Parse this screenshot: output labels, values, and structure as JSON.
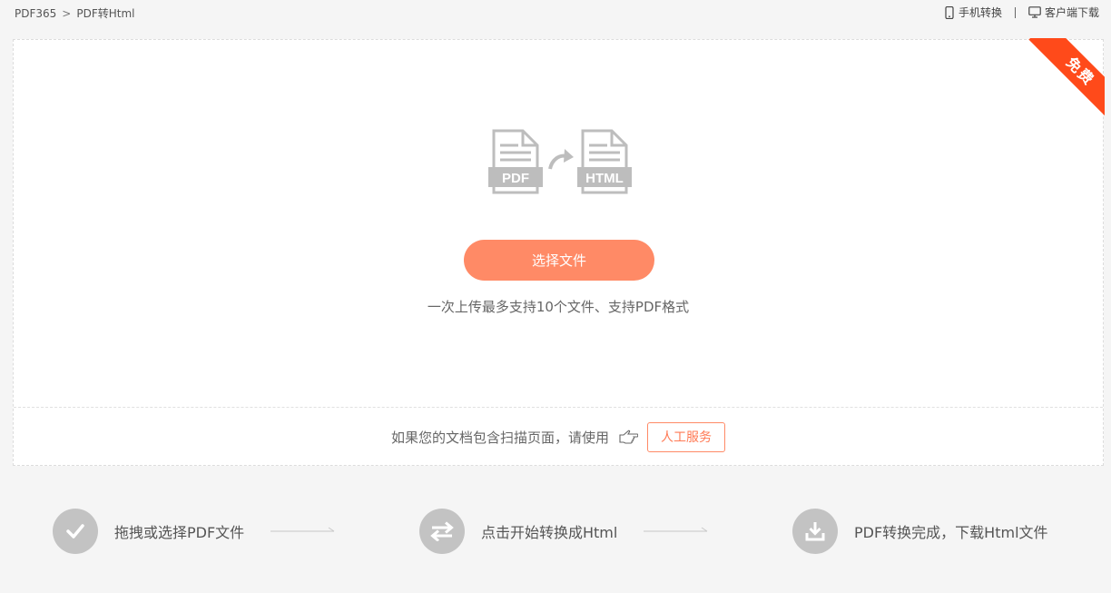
{
  "breadcrumb": {
    "home": "PDF365",
    "separator": ">",
    "current": "PDF转Html"
  },
  "top_links": {
    "mobile": "手机转换",
    "desktop": "客户端下载"
  },
  "ribbon": {
    "label": "免费"
  },
  "convert_icon": {
    "from": "PDF",
    "to": "HTML"
  },
  "upload": {
    "button_label": "选择文件",
    "hint": "一次上传最多支持10个文件、支持PDF格式"
  },
  "service": {
    "text": "如果您的文档包含扫描页面，请使用",
    "button_label": "人工服务"
  },
  "steps": [
    {
      "label": "拖拽或选择PDF文件",
      "icon": "check-icon"
    },
    {
      "label": "点击开始转换成Html",
      "icon": "swap-arrows-icon"
    },
    {
      "label": "PDF转换完成，下载Html文件",
      "icon": "download-icon"
    }
  ],
  "colors": {
    "accent": "#ff8a66",
    "ribbon": "#ff4a1a",
    "step_circle": "#c3c3c3",
    "icon_gray": "#bdbdbd"
  }
}
